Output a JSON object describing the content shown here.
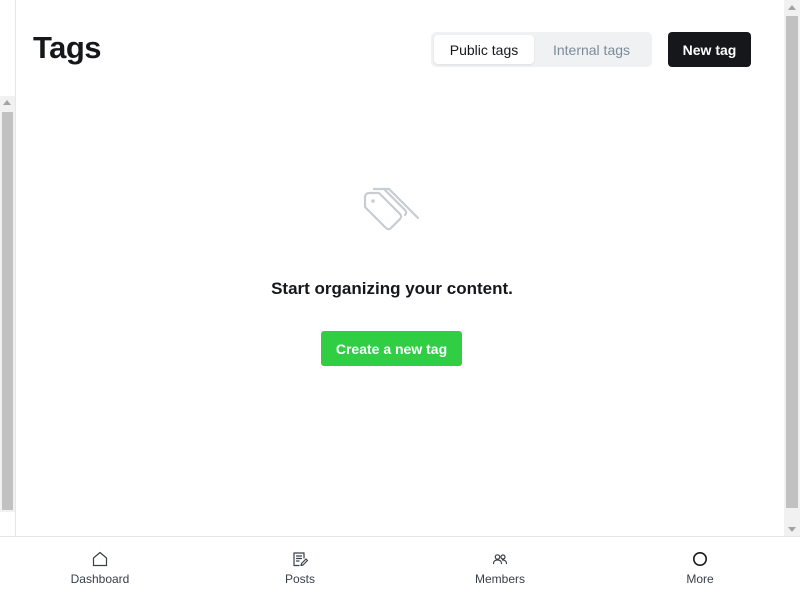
{
  "header": {
    "title": "Tags",
    "tabs": [
      {
        "label": "Public tags",
        "active": true
      },
      {
        "label": "Internal tags",
        "active": false
      }
    ],
    "new_tag_label": "New tag"
  },
  "empty_state": {
    "icon": "tag-icon",
    "message": "Start organizing your content.",
    "create_label": "Create a new tag"
  },
  "bottom_nav": [
    {
      "label": "Dashboard",
      "icon": "home-icon"
    },
    {
      "label": "Posts",
      "icon": "edit-icon"
    },
    {
      "label": "Members",
      "icon": "members-icon"
    },
    {
      "label": "More",
      "icon": "circle-icon"
    }
  ],
  "colors": {
    "primary_dark": "#15171a",
    "accent_green": "#30cf43",
    "muted_text": "#7c8b9a",
    "segment_bg": "#eff1f3"
  }
}
